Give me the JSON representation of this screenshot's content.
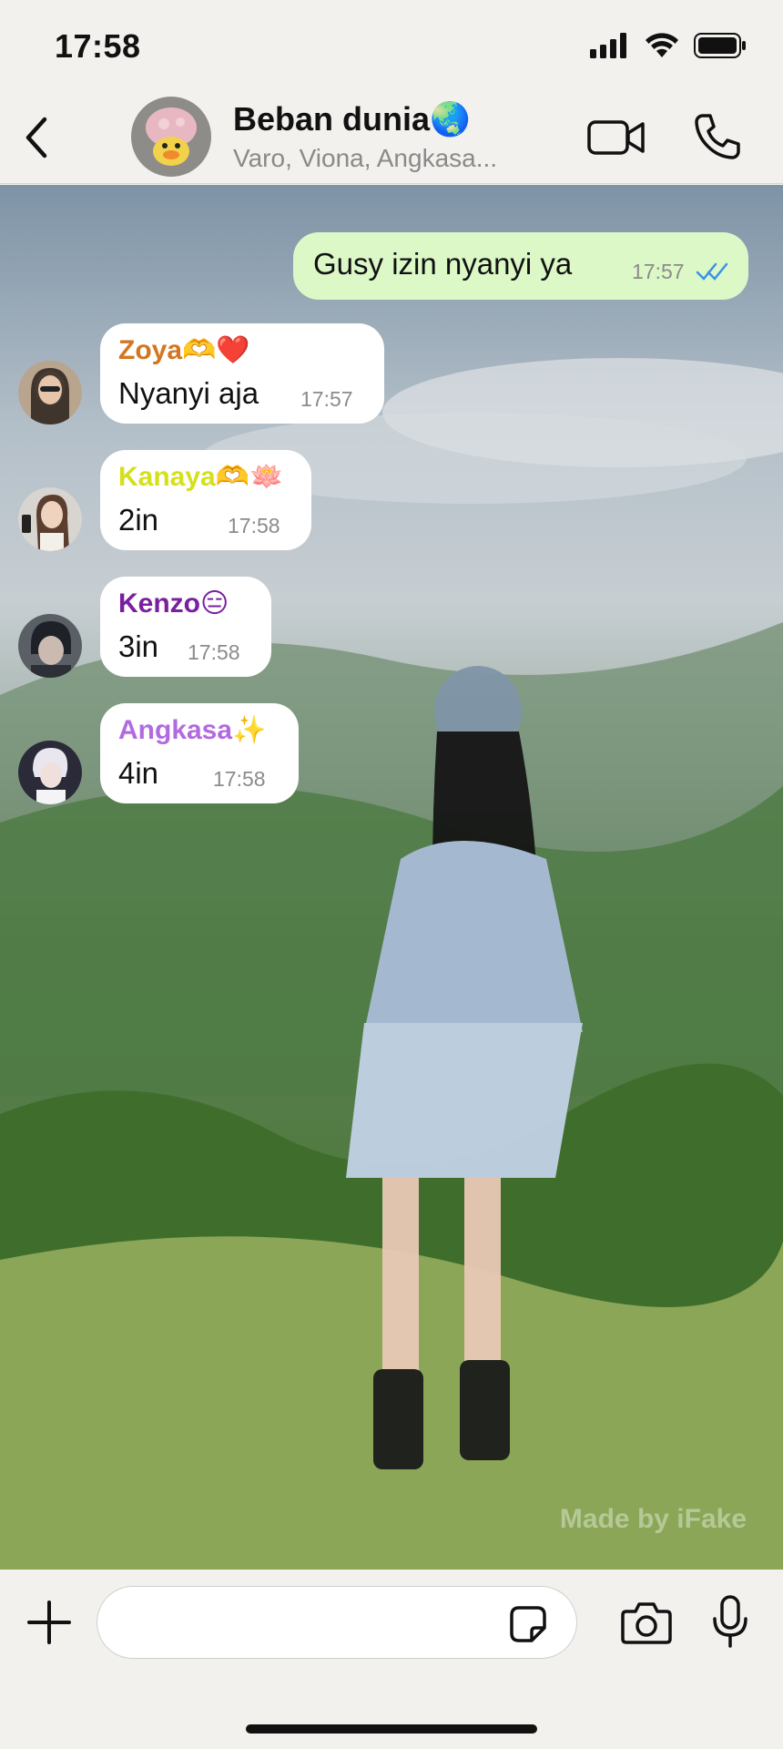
{
  "status_bar": {
    "time": "17:58"
  },
  "header": {
    "title": "Beban dunia🌏",
    "members": "Varo, Viona, Angkasa..."
  },
  "messages": [
    {
      "direction": "out",
      "text": "Gusy izin nyanyi ya",
      "time": "17:57",
      "status": "read"
    },
    {
      "direction": "in",
      "sender": "Zoya🫶❤️",
      "sender_color": "#d4761f",
      "text": "Nyanyi aja",
      "time": "17:57"
    },
    {
      "direction": "in",
      "sender": "Kanaya🫶🪷",
      "sender_color": "#d5e01c",
      "text": "2in",
      "time": "17:58"
    },
    {
      "direction": "in",
      "sender": "Kenzo😑",
      "sender_color": "#7a1fa0",
      "text": "3in",
      "time": "17:58"
    },
    {
      "direction": "in",
      "sender": "Angkasa✨",
      "sender_color": "#b16be0",
      "text": "4in",
      "time": "17:58"
    }
  ],
  "watermark": "Made by iFake",
  "input": {
    "placeholder": ""
  },
  "colors": {
    "outgoing_bubble": "#dcf8c7",
    "incoming_bubble": "#ffffff",
    "read_ticks": "#3b93e8"
  },
  "icons": [
    "chevron-left-icon",
    "video-icon",
    "phone-icon",
    "plus-icon",
    "sticker-icon",
    "camera-icon",
    "microphone-icon"
  ]
}
